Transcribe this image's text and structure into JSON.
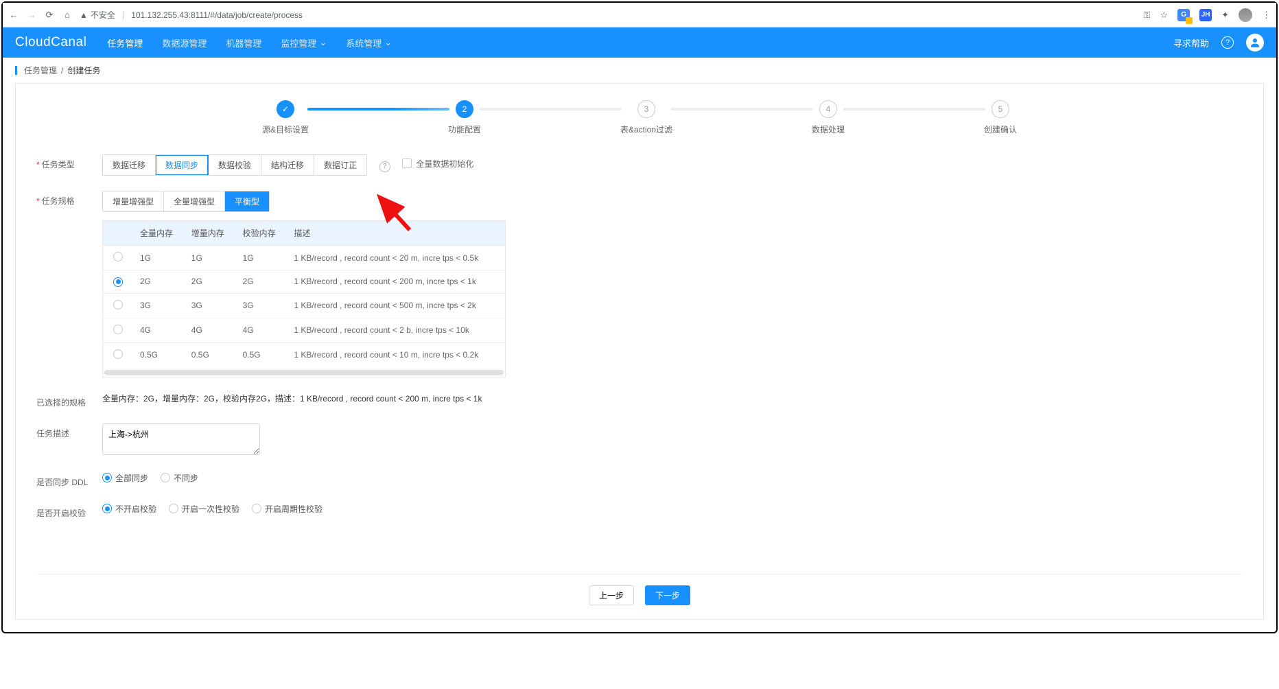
{
  "browser": {
    "insecure_label": "不安全",
    "url": "101.132.255.43:8111/#/data/job/create/process"
  },
  "nav": {
    "logo": "CloudCanal",
    "items": [
      "任务管理",
      "数据源管理",
      "机器管理",
      "监控管理",
      "系统管理"
    ],
    "active_index": 0,
    "help": "寻求帮助"
  },
  "breadcrumb": {
    "root": "任务管理",
    "current": "创建任务"
  },
  "steps": [
    {
      "label": "源&目标设置",
      "num": "✓",
      "state": "done"
    },
    {
      "label": "功能配置",
      "num": "2",
      "state": "active"
    },
    {
      "label": "表&action过滤",
      "num": "3",
      "state": "pending"
    },
    {
      "label": "数据处理",
      "num": "4",
      "state": "pending"
    },
    {
      "label": "创建确认",
      "num": "5",
      "state": "pending"
    }
  ],
  "labels": {
    "task_type": "任务类型",
    "task_spec": "任务规格",
    "selected_spec": "已选择的规格",
    "task_desc": "任务描述",
    "sync_ddl": "是否同步 DDL",
    "enable_verify": "是否开启校验"
  },
  "task_type": {
    "options": [
      "数据迁移",
      "数据同步",
      "数据校验",
      "结构迁移",
      "数据订正"
    ],
    "selected_index": 1,
    "checkbox_label": "全量数据初始化",
    "checkbox_checked": false
  },
  "task_spec": {
    "options": [
      "增量增强型",
      "全量增强型",
      "平衡型"
    ],
    "selected_index": 2,
    "headers": [
      "",
      "全量内存",
      "增量内存",
      "校验内存",
      "描述"
    ],
    "rows": [
      {
        "sel": false,
        "full": "1G",
        "incr": "1G",
        "chk": "1G",
        "desc": "1 KB/record , record count < 20 m, incre tps < 0.5k"
      },
      {
        "sel": true,
        "full": "2G",
        "incr": "2G",
        "chk": "2G",
        "desc": "1 KB/record , record count < 200 m, incre tps < 1k"
      },
      {
        "sel": false,
        "full": "3G",
        "incr": "3G",
        "chk": "3G",
        "desc": "1 KB/record , record count < 500 m, incre tps < 2k"
      },
      {
        "sel": false,
        "full": "4G",
        "incr": "4G",
        "chk": "4G",
        "desc": "1 KB/record , record count < 2 b, incre tps < 10k"
      },
      {
        "sel": false,
        "full": "0.5G",
        "incr": "0.5G",
        "chk": "0.5G",
        "desc": "1 KB/record , record count < 10 m, incre tps < 0.2k"
      }
    ]
  },
  "selected_spec_summary": "全量内存：2G，增量内存：2G，校验内存2G，描述：1 KB/record , record count < 200 m, incre tps < 1k",
  "task_desc": "上海->杭州",
  "sync_ddl": {
    "options": [
      "全部同步",
      "不同步"
    ],
    "selected_index": 0
  },
  "enable_verify": {
    "options": [
      "不开启校验",
      "开启一次性校验",
      "开启周期性校验"
    ],
    "selected_index": 0
  },
  "footer": {
    "prev": "上一步",
    "next": "下一步"
  }
}
